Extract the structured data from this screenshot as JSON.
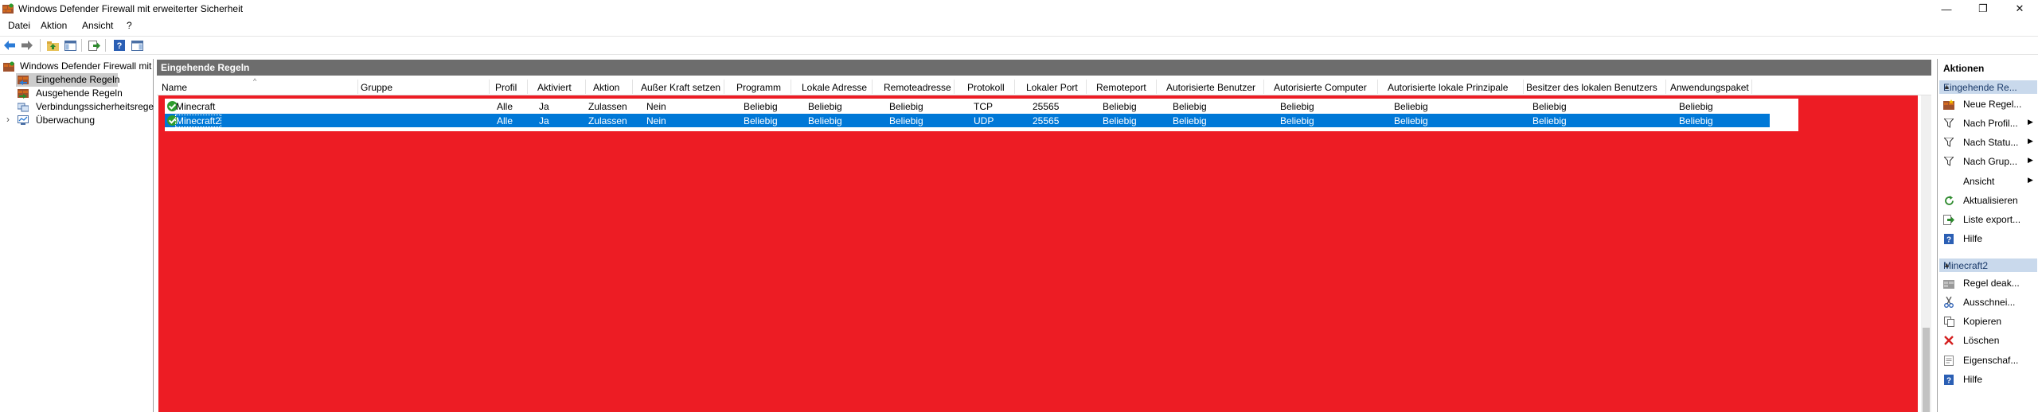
{
  "window": {
    "title": "Windows Defender Firewall mit erweiterter Sicherheit",
    "controls": {
      "minimize": "—",
      "maximize": "❐",
      "close": "✕"
    }
  },
  "menu": [
    "Datei",
    "Aktion",
    "Ansicht",
    "?"
  ],
  "tree": {
    "root": "Windows Defender Firewall mit",
    "items": [
      "Eingehende Regeln",
      "Ausgehende Regeln",
      "Verbindungssicherheitsrege",
      "Überwachung"
    ],
    "expander": "›"
  },
  "panel": {
    "header": "Eingehende Regeln",
    "sort_indicator": "^",
    "columns": [
      "Name",
      "Gruppe",
      "Profil",
      "Aktiviert",
      "Aktion",
      "Außer Kraft setzen",
      "Programm",
      "Lokale Adresse",
      "Remoteadresse",
      "Protokoll",
      "Lokaler Port",
      "Remoteport",
      "Autorisierte Benutzer",
      "Autorisierte Computer",
      "Autorisierte lokale Prinzipale",
      "Besitzer des lokalen Benutzers",
      "Anwendungspaket"
    ],
    "rows": [
      {
        "name": "Minecraft",
        "profil": "Alle",
        "aktiviert": "Ja",
        "aktion": "Zulassen",
        "ausser_kraft": "Nein",
        "programm": "Beliebig",
        "lokale_adresse": "Beliebig",
        "remoteadresse": "Beliebig",
        "protokoll": "TCP",
        "lokaler_port": "25565",
        "remoteport": "Beliebig",
        "auth_benutzer": "Beliebig",
        "auth_computer": "Beliebig",
        "auth_prinzipale": "Beliebig",
        "besitzer": "Beliebig",
        "paket": "Beliebig",
        "selected": false
      },
      {
        "name": "Minecraft2",
        "profil": "Alle",
        "aktiviert": "Ja",
        "aktion": "Zulassen",
        "ausser_kraft": "Nein",
        "programm": "Beliebig",
        "lokale_adresse": "Beliebig",
        "remoteadresse": "Beliebig",
        "protokoll": "UDP",
        "lokaler_port": "25565",
        "remoteport": "Beliebig",
        "auth_benutzer": "Beliebig",
        "auth_computer": "Beliebig",
        "auth_prinzipale": "Beliebig",
        "besitzer": "Beliebig",
        "paket": "Beliebig",
        "selected": true
      }
    ]
  },
  "actions": {
    "title": "Aktionen",
    "section1": "Eingehende Re...",
    "section1_items": [
      {
        "label": "Neue Regel...",
        "icon": "new-rule-icon",
        "submenu": false
      },
      {
        "label": "Nach Profil...",
        "icon": "filter-icon",
        "submenu": true
      },
      {
        "label": "Nach Statu...",
        "icon": "filter-icon",
        "submenu": true
      },
      {
        "label": "Nach Grup...",
        "icon": "filter-icon",
        "submenu": true
      },
      {
        "label": "Ansicht",
        "icon": "",
        "submenu": true
      },
      {
        "label": "Aktualisieren",
        "icon": "refresh-icon",
        "submenu": false
      },
      {
        "label": "Liste export...",
        "icon": "export-icon",
        "submenu": false
      },
      {
        "label": "Hilfe",
        "icon": "help-icon",
        "submenu": false
      }
    ],
    "section2": "Minecraft2",
    "section2_items": [
      {
        "label": "Regel deak...",
        "icon": "disable-rule-icon",
        "submenu": false
      },
      {
        "label": "Ausschnei...",
        "icon": "cut-icon",
        "submenu": false
      },
      {
        "label": "Kopieren",
        "icon": "copy-icon",
        "submenu": false
      },
      {
        "label": "Löschen",
        "icon": "delete-icon",
        "submenu": false
      },
      {
        "label": "Eigenschaf...",
        "icon": "properties-icon",
        "submenu": false
      },
      {
        "label": "Hilfe",
        "icon": "help-icon",
        "submenu": false
      }
    ],
    "submenu_arrow": "▶",
    "collapse_caret": "▲"
  },
  "colors": {
    "red_fill": "#ed1c24",
    "selection": "#0078d7",
    "header_gray": "#6d6d6d",
    "section_blue": "#c9d9ec"
  }
}
